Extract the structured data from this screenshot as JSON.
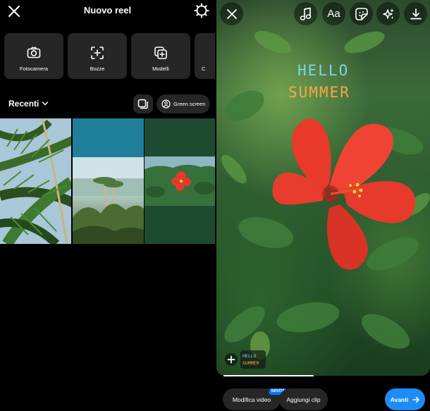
{
  "left": {
    "title": "Nuovo reel",
    "tiles": [
      {
        "label": "Fotocamera",
        "icon": "camera-icon"
      },
      {
        "label": "Bozze",
        "icon": "drafts-icon"
      },
      {
        "label": "Modelli",
        "icon": "templates-icon"
      },
      {
        "label": "C",
        "icon": "collab-icon"
      }
    ],
    "recent_label": "Recenti",
    "green_screen_label": "Green screen",
    "gallery": [
      "palm-leaves-photo",
      "beach-palm-photo",
      "hibiscus-photo"
    ]
  },
  "right": {
    "sticker_line1": "HELLO",
    "sticker_line2": "SUMMER",
    "clip_thumb_line1": "HELLO",
    "clip_thumb_line2": "SUMMER",
    "edit_video_label": "Modifica video",
    "new_badge": "NOVITÀ",
    "add_clip_label": "Aggiungi clip",
    "next_label": "Avanti"
  },
  "colors": {
    "accent_blue": "#1d8cf5",
    "tile_bg": "#262626",
    "hibiscus_red": "#e23a2c"
  }
}
